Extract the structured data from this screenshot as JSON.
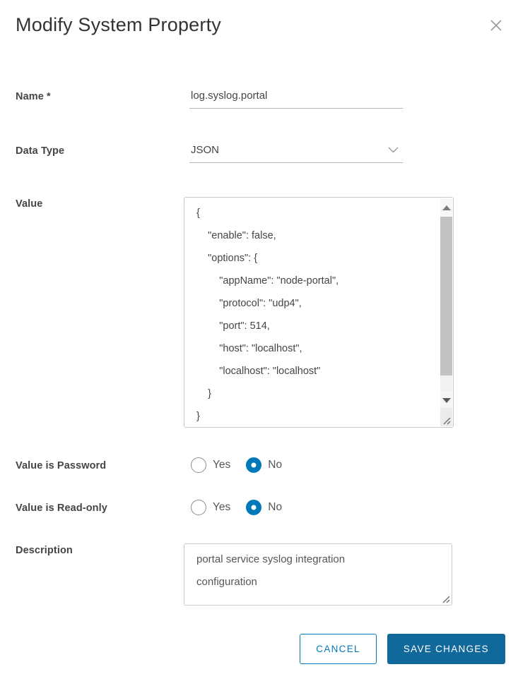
{
  "dialog": {
    "title": "Modify System Property"
  },
  "form": {
    "name": {
      "label": "Name *",
      "value": "log.syslog.portal"
    },
    "data_type": {
      "label": "Data Type",
      "value": "JSON"
    },
    "value": {
      "label": "Value",
      "text": "{\n    \"enable\": false,\n    \"options\": {\n        \"appName\": \"node-portal\",\n        \"protocol\": \"udp4\",\n        \"port\": 514,\n        \"host\": \"localhost\",\n        \"localhost\": \"localhost\"\n    }\n}"
    },
    "value_is_password": {
      "label": "Value is Password",
      "options": [
        "Yes",
        "No"
      ],
      "selected": "No"
    },
    "value_is_readonly": {
      "label": "Value is Read-only",
      "options": [
        "Yes",
        "No"
      ],
      "selected": "No"
    },
    "description": {
      "label": "Description",
      "value": "portal service syslog integration configuration"
    }
  },
  "footer": {
    "cancel_label": "CANCEL",
    "save_label": "SAVE CHANGES"
  },
  "icons": {
    "close": "close-icon",
    "chevron": "chevron-down-icon",
    "resize": "resize-grip-icon"
  },
  "colors": {
    "accent_blue": "#0079b8",
    "primary_button_bg": "#11699b",
    "label_text": "#454545",
    "border_gray": "#c9c9c9"
  }
}
